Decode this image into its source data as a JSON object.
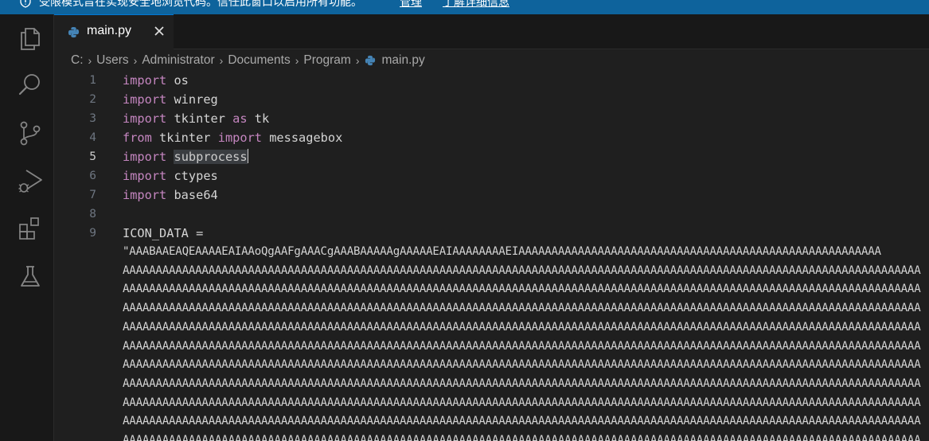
{
  "banner": {
    "message": "受限模式旨在实现安全地浏览代码。信任此窗口以启用所有功能。",
    "manage_link": "管理",
    "learn_more_link": "了解详细信息"
  },
  "activity_bar": {
    "items": [
      "explorer-icon",
      "search-icon",
      "source-control-icon",
      "run-debug-icon",
      "extensions-icon",
      "testing-icon"
    ]
  },
  "tabs": [
    {
      "label": "main.py",
      "icon": "python-file-icon"
    }
  ],
  "breadcrumb": [
    "C:",
    "Users",
    "Administrator",
    "Documents",
    "Program",
    "main.py"
  ],
  "editor": {
    "active_line": 5,
    "line_numbers": [
      "1",
      "2",
      "3",
      "4",
      "5",
      "6",
      "7",
      "8",
      "9"
    ],
    "lines": [
      [
        {
          "t": "import",
          "c": "kw"
        },
        {
          "t": " os",
          "c": "id"
        }
      ],
      [
        {
          "t": "import",
          "c": "kw"
        },
        {
          "t": " winreg",
          "c": "id"
        }
      ],
      [
        {
          "t": "import",
          "c": "kw"
        },
        {
          "t": " tkinter ",
          "c": "id"
        },
        {
          "t": "as",
          "c": "kw"
        },
        {
          "t": " tk",
          "c": "id"
        }
      ],
      [
        {
          "t": "from",
          "c": "kw"
        },
        {
          "t": " tkinter ",
          "c": "id"
        },
        {
          "t": "import",
          "c": "kw"
        },
        {
          "t": " messagebox",
          "c": "id"
        }
      ],
      [
        {
          "t": "import",
          "c": "kw"
        },
        {
          "t": " ",
          "c": "id"
        },
        {
          "t": "subprocess",
          "c": "sel"
        }
      ],
      [
        {
          "t": "import",
          "c": "kw"
        },
        {
          "t": " ctypes",
          "c": "id"
        }
      ],
      [
        {
          "t": "import",
          "c": "kw"
        },
        {
          "t": " base64",
          "c": "id"
        }
      ],
      [],
      [
        {
          "t": "ICON_DATA =",
          "c": "id"
        }
      ]
    ],
    "wrapped_lines": [
      "\"AAABAAEAQEAAAAEAIAAoQgAAFgAAACgAAABAAAAAgAAAAAEAIAAAAAAAAEIAAAAAAAAAAAAAAAAAAAAAAAAAAAAAAAAAAAAAAAAAAAAAAAAAAAAAAA",
      "AAAAAAAAAAAAAAAAAAAAAAAAAAAAAAAAAAAAAAAAAAAAAAAAAAAAAAAAAAAAAAAAAAAAAAAAAAAAAAAAAAAAAAAAAAAAAAAAAAAAAAAAAAAAAAAAAAAAAAAAA",
      "AAAAAAAAAAAAAAAAAAAAAAAAAAAAAAAAAAAAAAAAAAAAAAAAAAAAAAAAAAAAAAAAAAAAAAAAAAAAAAAAAAAAAAAAAAAAAAAAAAAAAAAAAAAAAAAAAAAAAAAAA",
      "AAAAAAAAAAAAAAAAAAAAAAAAAAAAAAAAAAAAAAAAAAAAAAAAAAAAAAAAAAAAAAAAAAAAAAAAAAAAAAAAAAAAAAAAAAAAAAAAAAAAAAAAAAAAAAAAAAAAAAAAA",
      "AAAAAAAAAAAAAAAAAAAAAAAAAAAAAAAAAAAAAAAAAAAAAAAAAAAAAAAAAAAAAAAAAAAAAAAAAAAAAAAAAAAAAAAAAAAAAAAAAAAAAAAAAAAAAAAAAAAAAAAAA",
      "AAAAAAAAAAAAAAAAAAAAAAAAAAAAAAAAAAAAAAAAAAAAAAAAAAAAAAAAAAAAAAAAAAAAAAAAAAAAAAAAAAAAAAAAAAAAAAAAAAAAAAAAAAAAAAAAAAAAAAAAA",
      "AAAAAAAAAAAAAAAAAAAAAAAAAAAAAAAAAAAAAAAAAAAAAAAAAAAAAAAAAAAAAAAAAAAAAAAAAAAAAAAAAAAAAAAAAAAAAAAAAAAAAAAAAAAAAAAAAAAAAAAAA",
      "AAAAAAAAAAAAAAAAAAAAAAAAAAAAAAAAAAAAAAAAAAAAAAAAAAAAAAAAAAAAAAAAAAAAAAAAAAAAAAAAAAAAAAAAAAAAAAAAAAAAAAAAAAAAAAAAAAAAAAAAA",
      "AAAAAAAAAAAAAAAAAAAAAAAAAAAAAAAAAAAAAAAAAAAAAAAAAAAAAAAAAAAAAAAAAAAAAAAAAAAAAAAAAAAAAAAAAAAAAAAAAAAAAAAAAAAAAAAAAAAAAAAAA",
      "AAAAAAAAAAAAAAAAAAAAAAAAAAAAAAAAAAAAAAAAAAAAAAAAAAAAAAAAAAAAAAAAAAAAAAAAAAAAAAAAAAAAAAAAAAAAAAAAAAAAAAAAAAAAAAAAAAAAAAAAA",
      "AAAAAAAAAAAAAAAAAAAAAAAAAAAAAAAAAAAAAAAAAAAAAAAAAAAAAAAAAAAAAAAAAAAAAAAAAAAAAAAAAAAAAAAAAAAAAAAAAAAAAAAAAAAAAAAAAAAAAAAAA"
    ]
  },
  "colors": {
    "banner_bg": "#0e639c",
    "keyword": "#c586c0",
    "identifier": "#d4d4d4",
    "editor_bg": "#1f1f1f",
    "tab_accent": "#0078d4"
  }
}
